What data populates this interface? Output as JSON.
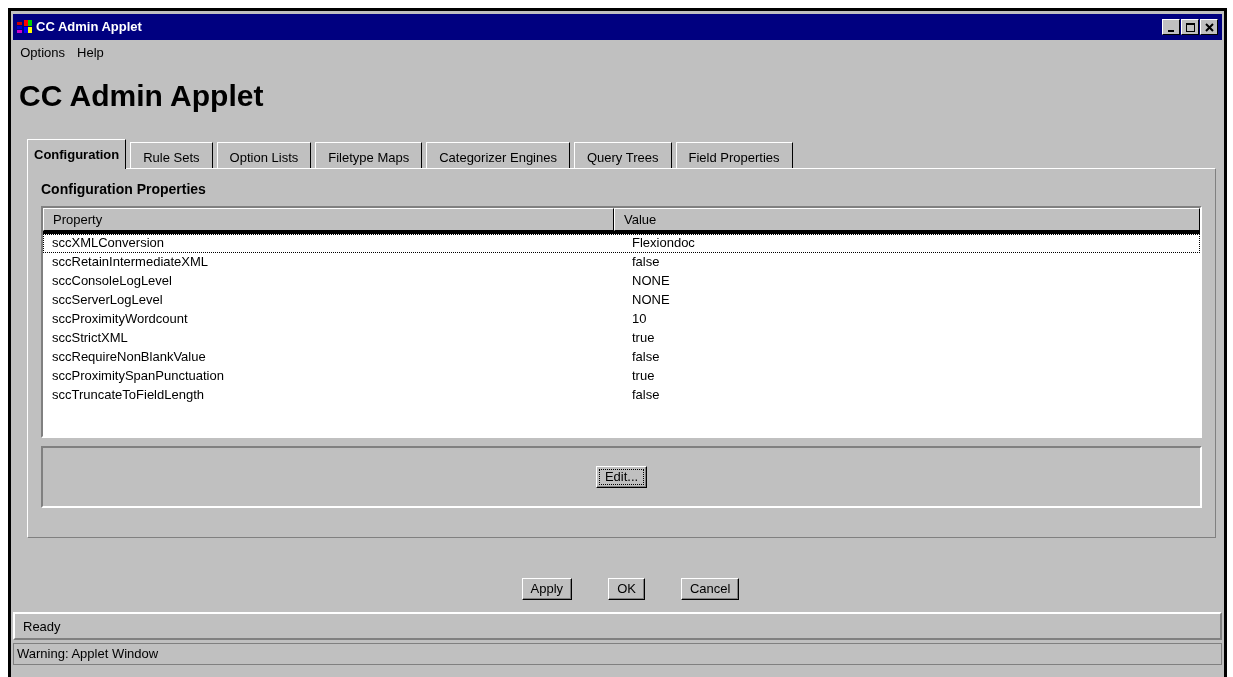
{
  "window": {
    "title": "CC Admin Applet"
  },
  "menu": [
    "Options",
    "Help"
  ],
  "heading": "CC Admin Applet",
  "tabs": [
    {
      "label": "Configuration",
      "selected": true
    },
    {
      "label": "Rule Sets",
      "selected": false
    },
    {
      "label": "Option Lists",
      "selected": false
    },
    {
      "label": "Filetype Maps",
      "selected": false
    },
    {
      "label": "Categorizer Engines",
      "selected": false
    },
    {
      "label": "Query Trees",
      "selected": false
    },
    {
      "label": "Field Properties",
      "selected": false
    }
  ],
  "section_title": "Configuration Properties",
  "table": {
    "columns": [
      "Property",
      "Value"
    ],
    "rows": [
      {
        "property": "sccXMLConversion",
        "value": "Flexiondoc",
        "selected": true
      },
      {
        "property": "sccRetainIntermediateXML",
        "value": "false",
        "selected": false
      },
      {
        "property": "sccConsoleLogLevel",
        "value": "NONE",
        "selected": false
      },
      {
        "property": "sccServerLogLevel",
        "value": "NONE",
        "selected": false
      },
      {
        "property": "sccProximityWordcount",
        "value": "10",
        "selected": false
      },
      {
        "property": "sccStrictXML",
        "value": "true",
        "selected": false
      },
      {
        "property": "sccRequireNonBlankValue",
        "value": "false",
        "selected": false
      },
      {
        "property": "sccProximitySpanPunctuation",
        "value": "true",
        "selected": false
      },
      {
        "property": "sccTruncateToFieldLength",
        "value": "false",
        "selected": false
      }
    ]
  },
  "edit_button": "Edit...",
  "buttons": [
    "Apply",
    "OK",
    "Cancel"
  ],
  "status_bar": "Ready",
  "warning": "Warning: Applet Window"
}
